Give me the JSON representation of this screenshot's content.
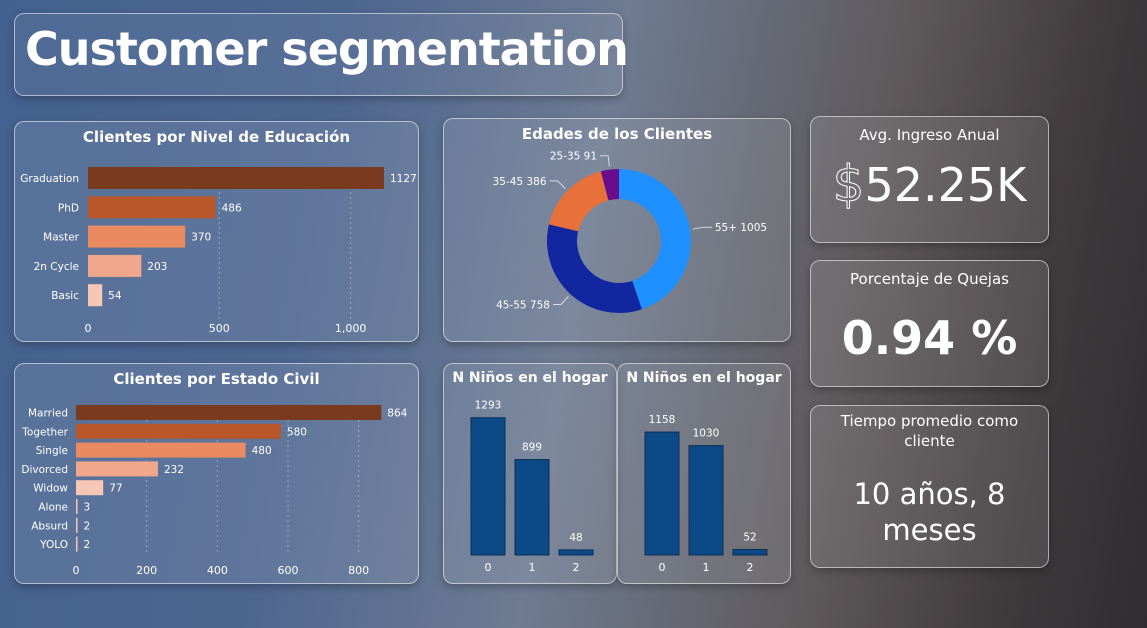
{
  "page_title": "Customer segmentation",
  "colors": {
    "bar_shades": [
      "#7a3a1e",
      "#b9572a",
      "#ea8a61",
      "#f0a78b",
      "#f5c7b4"
    ],
    "donut": [
      "#1e90ff",
      "#1226a0",
      "#e8703a",
      "#6a0d8c"
    ],
    "column": "#0b4a86"
  },
  "chart_data": [
    {
      "type": "bar",
      "orientation": "horizontal",
      "title": "Clientes por Nivel de Educación",
      "categories": [
        "Graduation",
        "PhD",
        "Master",
        "2n Cycle",
        "Basic"
      ],
      "values": [
        1127,
        486,
        370,
        203,
        54
      ],
      "xlim": [
        0,
        1150
      ],
      "xticks": [
        0,
        500,
        1000
      ],
      "xtick_labels": [
        "0",
        "500",
        "1,000"
      ],
      "grid": true
    },
    {
      "type": "bar",
      "orientation": "horizontal",
      "title": "Clientes por Estado Civil",
      "categories": [
        "Married",
        "Together",
        "Single",
        "Divorced",
        "Widow",
        "Alone",
        "Absurd",
        "YOLO"
      ],
      "values": [
        864,
        580,
        480,
        232,
        77,
        3,
        2,
        2
      ],
      "xlim": [
        0,
        900
      ],
      "xticks": [
        0,
        200,
        400,
        600,
        800
      ],
      "xtick_labels": [
        "0",
        "200",
        "400",
        "600",
        "800"
      ],
      "grid": true
    },
    {
      "type": "pie",
      "donut": true,
      "title": "Edades de los Clientes",
      "labels": [
        "55+",
        "45-55",
        "35-45",
        "25-35"
      ],
      "values": [
        1005,
        758,
        386,
        91
      ]
    },
    {
      "type": "bar",
      "title": "N Niños en el hogar",
      "categories": [
        "0",
        "1",
        "2"
      ],
      "values": [
        1293,
        899,
        48
      ]
    },
    {
      "type": "bar",
      "title": "N Niños en el hogar",
      "categories": [
        "0",
        "1",
        "2"
      ],
      "values": [
        1158,
        1030,
        52
      ]
    }
  ],
  "kpis": {
    "income": {
      "title": "Avg. Ingreso Anual",
      "currency": "$",
      "value": "52.25K"
    },
    "complaints": {
      "title": "Porcentaje de Quejas",
      "value": "0.94 %"
    },
    "tenure": {
      "title_line1": "Tiempo promedio como",
      "title_line2": "cliente",
      "value_line1": "10 años, 8",
      "value_line2": "meses"
    }
  }
}
